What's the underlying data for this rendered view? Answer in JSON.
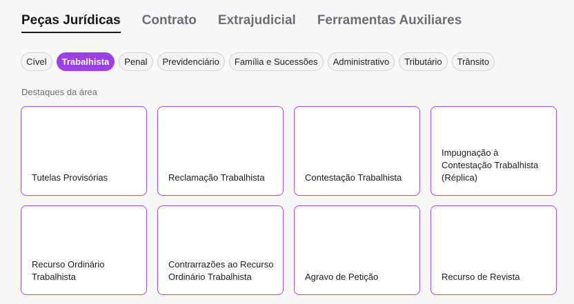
{
  "main_tabs": [
    {
      "label": "Peças Jurídicas",
      "active": true
    },
    {
      "label": "Contrato",
      "active": false
    },
    {
      "label": "Extrajudicial",
      "active": false
    },
    {
      "label": "Ferramentas Auxiliares",
      "active": false
    }
  ],
  "area_chips": [
    {
      "label": "Cível",
      "active": false
    },
    {
      "label": "Trabalhista",
      "active": true
    },
    {
      "label": "Penal",
      "active": false
    },
    {
      "label": "Previdenciário",
      "active": false
    },
    {
      "label": "Família e Sucessões",
      "active": false
    },
    {
      "label": "Administrativo",
      "active": false
    },
    {
      "label": "Tributário",
      "active": false
    },
    {
      "label": "Trânsito",
      "active": false
    }
  ],
  "highlights": {
    "label": "Destaques da área",
    "cards": [
      {
        "title": "Tutelas Provisórias"
      },
      {
        "title": "Reclamação Trabalhista"
      },
      {
        "title": "Contestação Trabalhista"
      },
      {
        "title": "Impugnação à Contestação Trabalhista (Réplica)"
      },
      {
        "title": "Recurso Ordinário Trabalhista"
      },
      {
        "title": "Contrarrazões ao Recurso Ordinário Trabalhista"
      },
      {
        "title": "Agravo de Petição"
      },
      {
        "title": "Recurso de Revista"
      }
    ]
  },
  "colors": {
    "accent": "#9d3fe8",
    "card_border": "#a24fe0",
    "background": "#f8f8f9"
  }
}
